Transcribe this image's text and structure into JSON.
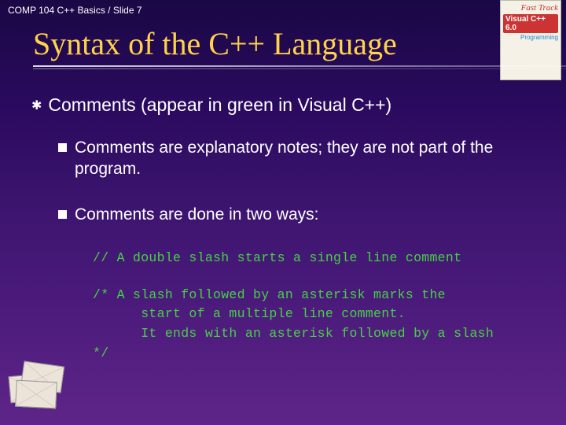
{
  "header": {
    "breadcrumb": "COMP 104 C++ Basics / Slide 7"
  },
  "title": "Syntax of the C++ Language",
  "book": {
    "line1": "Fast Track",
    "line2": "Visual C++ 6.0",
    "line3": "Programming"
  },
  "bullets": {
    "main": "Comments (appear in green in Visual C++)",
    "sub1": "Comments are explanatory notes; they are not part of the program.",
    "sub2": "Comments are done in two ways:"
  },
  "code": {
    "single": "// A double slash starts a single line comment",
    "multi": "/* A slash followed by an asterisk marks the\n      start of a multiple line comment.\n      It ends with an asterisk followed by a slash\n*/"
  }
}
